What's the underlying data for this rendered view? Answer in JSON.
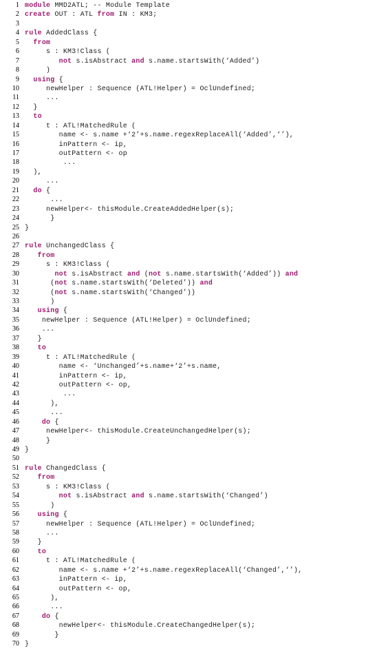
{
  "document": {
    "kind": "source-code-listing",
    "language": "ATL",
    "module_name": "MMD2ATL",
    "first_line_number": 1,
    "last_line_number": 70,
    "total_lines": 70,
    "keyword_color": "#9c1a6e",
    "text_color": "#1a1a1a",
    "background_color": "#ffffff"
  },
  "keywords": [
    "module",
    "create",
    "from",
    "rule",
    "using",
    "to",
    "do",
    "not",
    "and"
  ],
  "lines": [
    {
      "n": "1",
      "tokens": [
        {
          "t": "kw",
          "s": "module"
        },
        {
          "t": "pl",
          "s": " MMD2ATL; -- Module Template"
        }
      ]
    },
    {
      "n": "2",
      "tokens": [
        {
          "t": "kw",
          "s": "create"
        },
        {
          "t": "pl",
          "s": " OUT : ATL "
        },
        {
          "t": "kw",
          "s": "from"
        },
        {
          "t": "pl",
          "s": " IN : KM3;"
        }
      ]
    },
    {
      "n": "3",
      "tokens": [
        {
          "t": "pl",
          "s": ""
        }
      ]
    },
    {
      "n": "4",
      "tokens": [
        {
          "t": "kw",
          "s": "rule"
        },
        {
          "t": "pl",
          "s": " AddedClass {"
        }
      ]
    },
    {
      "n": "5",
      "tokens": [
        {
          "t": "pl",
          "s": "  "
        },
        {
          "t": "kw",
          "s": "from"
        }
      ]
    },
    {
      "n": "6",
      "tokens": [
        {
          "t": "pl",
          "s": "     s : KM3!Class ("
        }
      ]
    },
    {
      "n": "7",
      "tokens": [
        {
          "t": "pl",
          "s": "        "
        },
        {
          "t": "kw",
          "s": "not"
        },
        {
          "t": "pl",
          "s": " s.isAbstract "
        },
        {
          "t": "kw",
          "s": "and"
        },
        {
          "t": "pl",
          "s": " s.name.startsWith(‘Added’)"
        }
      ]
    },
    {
      "n": "8",
      "tokens": [
        {
          "t": "pl",
          "s": "     )"
        }
      ]
    },
    {
      "n": "9",
      "tokens": [
        {
          "t": "pl",
          "s": "  "
        },
        {
          "t": "kw",
          "s": "using"
        },
        {
          "t": "pl",
          "s": " {"
        }
      ]
    },
    {
      "n": "10",
      "tokens": [
        {
          "t": "pl",
          "s": "     newHelper : Sequence (ATL!Helper) = OclUndefined;"
        }
      ]
    },
    {
      "n": "11",
      "tokens": [
        {
          "t": "pl",
          "s": "     ..."
        }
      ]
    },
    {
      "n": "12",
      "tokens": [
        {
          "t": "pl",
          "s": "  }"
        }
      ]
    },
    {
      "n": "13",
      "tokens": [
        {
          "t": "pl",
          "s": "  "
        },
        {
          "t": "kw",
          "s": "to"
        }
      ]
    },
    {
      "n": "14",
      "tokens": [
        {
          "t": "pl",
          "s": "     t : ATL!MatchedRule ("
        }
      ]
    },
    {
      "n": "15",
      "tokens": [
        {
          "t": "pl",
          "s": "        name <- s.name +‘2’+s.name.regexReplaceAll(‘Added’,‘’),"
        }
      ]
    },
    {
      "n": "16",
      "tokens": [
        {
          "t": "pl",
          "s": "        inPattern <- ip,"
        }
      ]
    },
    {
      "n": "17",
      "tokens": [
        {
          "t": "pl",
          "s": "        outPattern <- op"
        }
      ]
    },
    {
      "n": "18",
      "tokens": [
        {
          "t": "pl",
          "s": "         ..."
        }
      ]
    },
    {
      "n": "19",
      "tokens": [
        {
          "t": "pl",
          "s": "  ),"
        }
      ]
    },
    {
      "n": "20",
      "tokens": [
        {
          "t": "pl",
          "s": "     ..."
        }
      ]
    },
    {
      "n": "21",
      "tokens": [
        {
          "t": "pl",
          "s": "  "
        },
        {
          "t": "kw",
          "s": "do"
        },
        {
          "t": "pl",
          "s": " {"
        }
      ]
    },
    {
      "n": "22",
      "tokens": [
        {
          "t": "pl",
          "s": "      ..."
        }
      ]
    },
    {
      "n": "23",
      "tokens": [
        {
          "t": "pl",
          "s": "     newHelper<- thisModule.CreateAddedHelper(s);"
        }
      ]
    },
    {
      "n": "24",
      "tokens": [
        {
          "t": "pl",
          "s": "      }"
        }
      ]
    },
    {
      "n": "25",
      "tokens": [
        {
          "t": "pl",
          "s": "}"
        }
      ]
    },
    {
      "n": "26",
      "tokens": [
        {
          "t": "pl",
          "s": ""
        }
      ]
    },
    {
      "n": "27",
      "tokens": [
        {
          "t": "kw",
          "s": "rule"
        },
        {
          "t": "pl",
          "s": " UnchangedClass {"
        }
      ]
    },
    {
      "n": "28",
      "tokens": [
        {
          "t": "pl",
          "s": "   "
        },
        {
          "t": "kw",
          "s": "from"
        }
      ]
    },
    {
      "n": "29",
      "tokens": [
        {
          "t": "pl",
          "s": "     s : KM3!Class ("
        }
      ]
    },
    {
      "n": "30",
      "tokens": [
        {
          "t": "pl",
          "s": "       "
        },
        {
          "t": "kw",
          "s": "not"
        },
        {
          "t": "pl",
          "s": " s.isAbstract "
        },
        {
          "t": "kw",
          "s": "and"
        },
        {
          "t": "pl",
          "s": " ("
        },
        {
          "t": "kw",
          "s": "not"
        },
        {
          "t": "pl",
          "s": " s.name.startsWith(‘Added’)) "
        },
        {
          "t": "kw",
          "s": "and"
        }
      ]
    },
    {
      "n": "31",
      "tokens": [
        {
          "t": "pl",
          "s": "      ("
        },
        {
          "t": "kw",
          "s": "not"
        },
        {
          "t": "pl",
          "s": " s.name.startsWith(‘Deleted’)) "
        },
        {
          "t": "kw",
          "s": "and"
        }
      ]
    },
    {
      "n": "32",
      "tokens": [
        {
          "t": "pl",
          "s": "      ("
        },
        {
          "t": "kw",
          "s": "not"
        },
        {
          "t": "pl",
          "s": " s.name.startsWith(‘Changed’))"
        }
      ]
    },
    {
      "n": "33",
      "tokens": [
        {
          "t": "pl",
          "s": "      )"
        }
      ]
    },
    {
      "n": "34",
      "tokens": [
        {
          "t": "pl",
          "s": "   "
        },
        {
          "t": "kw",
          "s": "using"
        },
        {
          "t": "pl",
          "s": " {"
        }
      ]
    },
    {
      "n": "35",
      "tokens": [
        {
          "t": "pl",
          "s": "    newHelper : Sequence (ATL!Helper) = OclUndefined;"
        }
      ]
    },
    {
      "n": "36",
      "tokens": [
        {
          "t": "pl",
          "s": "    ..."
        }
      ]
    },
    {
      "n": "37",
      "tokens": [
        {
          "t": "pl",
          "s": "   }"
        }
      ]
    },
    {
      "n": "38",
      "tokens": [
        {
          "t": "pl",
          "s": "   "
        },
        {
          "t": "kw",
          "s": "to"
        }
      ]
    },
    {
      "n": "39",
      "tokens": [
        {
          "t": "pl",
          "s": "     t : ATL!MatchedRule ("
        }
      ]
    },
    {
      "n": "40",
      "tokens": [
        {
          "t": "pl",
          "s": "        name <- ‘Unchanged’+s.name+‘2’+s.name,"
        }
      ]
    },
    {
      "n": "41",
      "tokens": [
        {
          "t": "pl",
          "s": "        inPattern <- ip,"
        }
      ]
    },
    {
      "n": "42",
      "tokens": [
        {
          "t": "pl",
          "s": "        outPattern <- op,"
        }
      ]
    },
    {
      "n": "43",
      "tokens": [
        {
          "t": "pl",
          "s": "         ..."
        }
      ]
    },
    {
      "n": "44",
      "tokens": [
        {
          "t": "pl",
          "s": "      ),"
        }
      ]
    },
    {
      "n": "45",
      "tokens": [
        {
          "t": "pl",
          "s": "      ..."
        }
      ]
    },
    {
      "n": "46",
      "tokens": [
        {
          "t": "pl",
          "s": "    "
        },
        {
          "t": "kw",
          "s": "do"
        },
        {
          "t": "pl",
          "s": " {"
        }
      ]
    },
    {
      "n": "47",
      "tokens": [
        {
          "t": "pl",
          "s": "     newHelper<- thisModule.CreateUnchangedHelper(s);"
        }
      ]
    },
    {
      "n": "48",
      "tokens": [
        {
          "t": "pl",
          "s": "     }"
        }
      ]
    },
    {
      "n": "49",
      "tokens": [
        {
          "t": "pl",
          "s": "}"
        }
      ]
    },
    {
      "n": "50",
      "tokens": [
        {
          "t": "pl",
          "s": ""
        }
      ]
    },
    {
      "n": "51",
      "tokens": [
        {
          "t": "kw",
          "s": "rule"
        },
        {
          "t": "pl",
          "s": " ChangedClass {"
        }
      ]
    },
    {
      "n": "52",
      "tokens": [
        {
          "t": "pl",
          "s": "   "
        },
        {
          "t": "kw",
          "s": "from"
        }
      ]
    },
    {
      "n": "53",
      "tokens": [
        {
          "t": "pl",
          "s": "     s : KM3!Class ("
        }
      ]
    },
    {
      "n": "54",
      "tokens": [
        {
          "t": "pl",
          "s": "        "
        },
        {
          "t": "kw",
          "s": "not"
        },
        {
          "t": "pl",
          "s": " s.isAbstract "
        },
        {
          "t": "kw",
          "s": "and"
        },
        {
          "t": "pl",
          "s": " s.name.startsWith(‘Changed’)"
        }
      ]
    },
    {
      "n": "55",
      "tokens": [
        {
          "t": "pl",
          "s": "      )"
        }
      ]
    },
    {
      "n": "56",
      "tokens": [
        {
          "t": "pl",
          "s": "   "
        },
        {
          "t": "kw",
          "s": "using"
        },
        {
          "t": "pl",
          "s": " {"
        }
      ]
    },
    {
      "n": "57",
      "tokens": [
        {
          "t": "pl",
          "s": "     newHelper : Sequence (ATL!Helper) = OclUndefined;"
        }
      ]
    },
    {
      "n": "58",
      "tokens": [
        {
          "t": "pl",
          "s": "     ..."
        }
      ]
    },
    {
      "n": "59",
      "tokens": [
        {
          "t": "pl",
          "s": "   }"
        }
      ]
    },
    {
      "n": "60",
      "tokens": [
        {
          "t": "pl",
          "s": "   "
        },
        {
          "t": "kw",
          "s": "to"
        }
      ]
    },
    {
      "n": "61",
      "tokens": [
        {
          "t": "pl",
          "s": "     t : ATL!MatchedRule ("
        }
      ]
    },
    {
      "n": "62",
      "tokens": [
        {
          "t": "pl",
          "s": "        name <- s.name +‘2’+s.name.regexReplaceAll(‘Changed’,‘’),"
        }
      ]
    },
    {
      "n": "63",
      "tokens": [
        {
          "t": "pl",
          "s": "        inPattern <- ip,"
        }
      ]
    },
    {
      "n": "64",
      "tokens": [
        {
          "t": "pl",
          "s": "        outPattern <- op,"
        }
      ]
    },
    {
      "n": "65",
      "tokens": [
        {
          "t": "pl",
          "s": "      ),"
        }
      ]
    },
    {
      "n": "66",
      "tokens": [
        {
          "t": "pl",
          "s": "      ..."
        }
      ]
    },
    {
      "n": "67",
      "tokens": [
        {
          "t": "pl",
          "s": "    "
        },
        {
          "t": "kw",
          "s": "do"
        },
        {
          "t": "pl",
          "s": " {"
        }
      ]
    },
    {
      "n": "68",
      "tokens": [
        {
          "t": "pl",
          "s": "        newHelper<- thisModule.CreateChangedHelper(s);"
        }
      ]
    },
    {
      "n": "69",
      "tokens": [
        {
          "t": "pl",
          "s": "       }"
        }
      ]
    },
    {
      "n": "70",
      "tokens": [
        {
          "t": "pl",
          "s": "}"
        }
      ]
    }
  ]
}
